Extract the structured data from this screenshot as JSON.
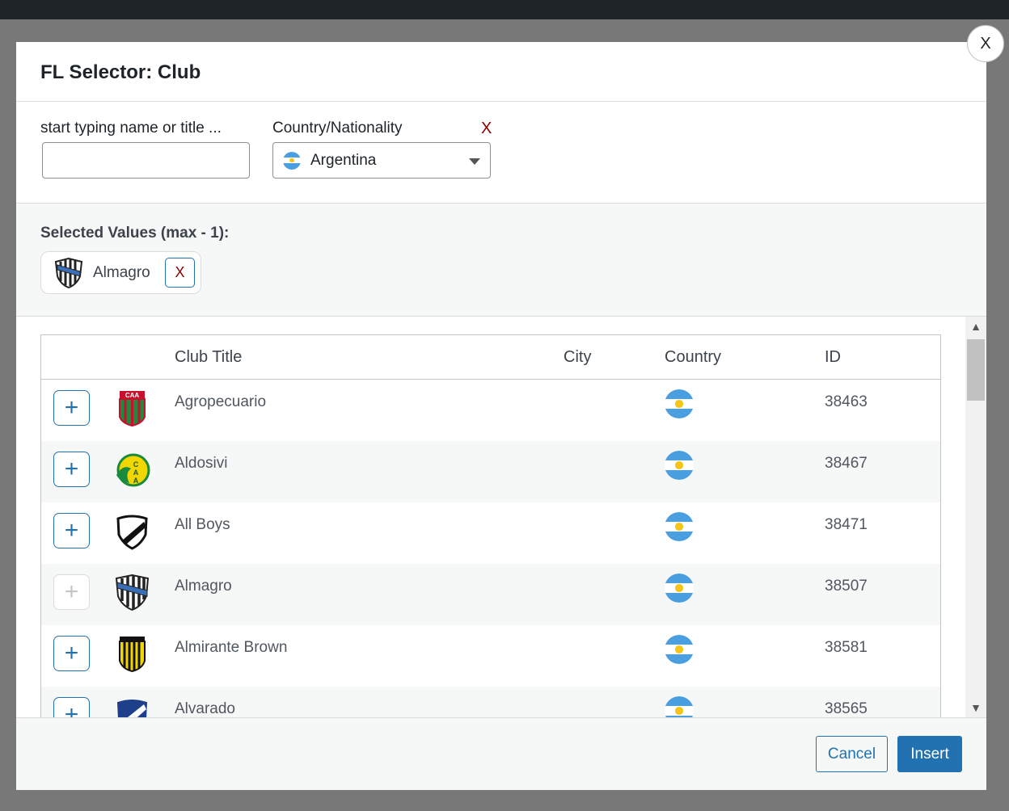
{
  "modal": {
    "title": "FL Selector: Club",
    "close_label": "X"
  },
  "filters": {
    "search_label": "start typing name or title ...",
    "search_value": "",
    "country_label": "Country/Nationality",
    "country_value": "Argentina",
    "country_clear_label": "X"
  },
  "selected": {
    "label": "Selected Values (max - 1):",
    "items": [
      {
        "name": "Almagro",
        "remove_label": "X"
      }
    ]
  },
  "table": {
    "headers": {
      "title": "Club Title",
      "city": "City",
      "country": "Country",
      "id": "ID"
    },
    "add_label": "+",
    "rows": [
      {
        "title": "Agropecuario",
        "city": "",
        "id": "38463",
        "logo": "agropecuario-logo",
        "disabled": false
      },
      {
        "title": "Aldosivi",
        "city": "",
        "id": "38467",
        "logo": "aldosivi-logo",
        "disabled": false
      },
      {
        "title": "All Boys",
        "city": "",
        "id": "38471",
        "logo": "all-boys-logo",
        "disabled": false
      },
      {
        "title": "Almagro",
        "city": "",
        "id": "38507",
        "logo": "almagro-logo",
        "disabled": true
      },
      {
        "title": "Almirante Brown",
        "city": "",
        "id": "38581",
        "logo": "almirante-brown-logo",
        "disabled": false
      },
      {
        "title": "Alvarado",
        "city": "",
        "id": "38565",
        "logo": "alvarado-logo",
        "disabled": false
      }
    ]
  },
  "footer": {
    "cancel_label": "Cancel",
    "insert_label": "Insert"
  },
  "colors": {
    "accent": "#2271b1",
    "danger": "#8a0000",
    "flag_blue": "#4a9fe0",
    "flag_sun": "#f5c518"
  }
}
